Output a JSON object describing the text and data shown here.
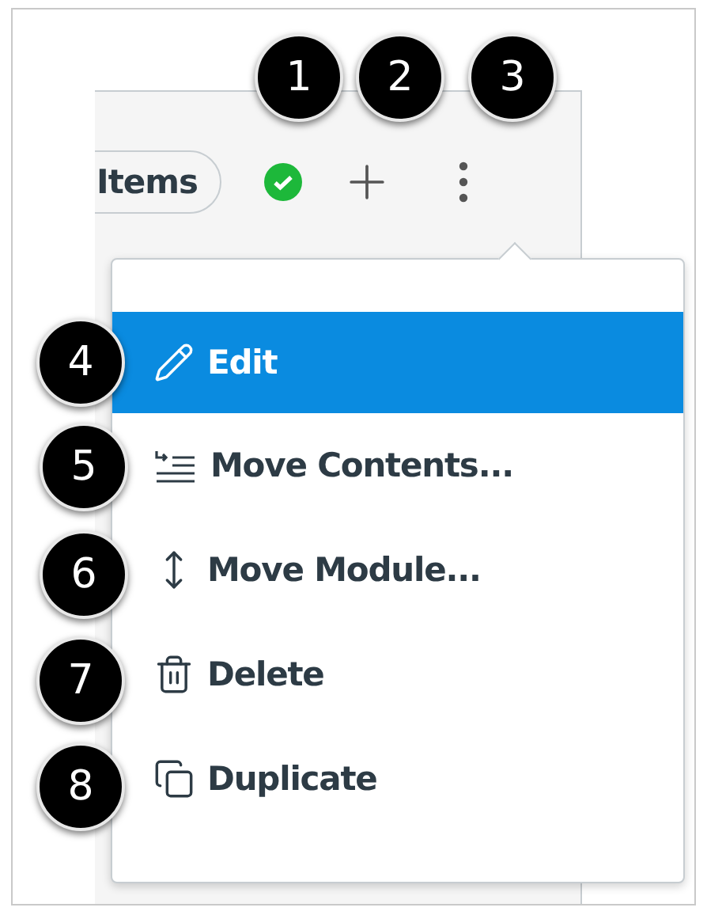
{
  "header": {
    "items_button": "Items",
    "published": true
  },
  "menu": {
    "items": [
      {
        "label": "Edit",
        "selected": true
      },
      {
        "label": "Move Contents...",
        "selected": false
      },
      {
        "label": "Move Module...",
        "selected": false
      },
      {
        "label": "Delete",
        "selected": false
      },
      {
        "label": "Duplicate",
        "selected": false
      }
    ]
  },
  "callouts": [
    "1",
    "2",
    "3",
    "4",
    "5",
    "6",
    "7",
    "8"
  ]
}
